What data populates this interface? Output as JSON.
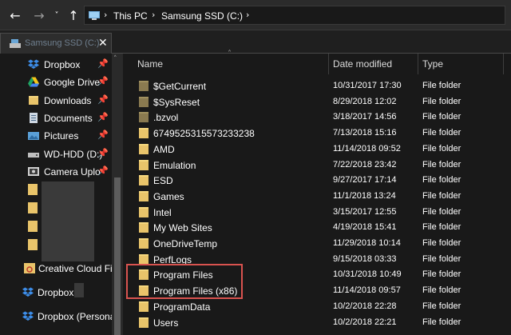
{
  "address_bar": {
    "path": [
      "This PC",
      "Samsung SSD (C:)"
    ]
  },
  "tab": {
    "label": "Samsung SSD (C:)"
  },
  "sidebar": {
    "items": [
      {
        "label": "Dropbox",
        "icon": "dropbox-icon",
        "pinned": true
      },
      {
        "label": "Google Drive",
        "icon": "google-drive-icon",
        "pinned": true
      },
      {
        "label": "Downloads",
        "icon": "folder-icon",
        "pinned": true
      },
      {
        "label": "Documents",
        "icon": "documents-icon",
        "pinned": true
      },
      {
        "label": "Pictures",
        "icon": "pictures-icon",
        "pinned": true
      },
      {
        "label": "WD-HDD (D:)",
        "icon": "drive-icon",
        "pinned": true
      },
      {
        "label": "Camera Uplo",
        "icon": "camera-icon",
        "pinned": true
      },
      {
        "label": "Creative Cloud Fil",
        "icon": "creative-cloud-icon",
        "pinned": false
      },
      {
        "label": "Dropbox",
        "icon": "dropbox-icon",
        "pinned": false
      },
      {
        "label": "Dropbox (Persona",
        "icon": "dropbox-icon",
        "pinned": false
      }
    ]
  },
  "columns": {
    "name": "Name",
    "date": "Date modified",
    "type": "Type"
  },
  "files": [
    {
      "name": "$GetCurrent",
      "date": "10/31/2017 17:30",
      "type": "File folder",
      "system": true
    },
    {
      "name": "$SysReset",
      "date": "8/29/2018 12:02",
      "type": "File folder",
      "system": true
    },
    {
      "name": ".bzvol",
      "date": "3/18/2017 14:56",
      "type": "File folder",
      "system": true
    },
    {
      "name": "6749525315573233238",
      "date": "7/13/2018 15:16",
      "type": "File folder",
      "system": false
    },
    {
      "name": "AMD",
      "date": "11/14/2018 09:52",
      "type": "File folder",
      "system": false
    },
    {
      "name": "Emulation",
      "date": "7/22/2018 23:42",
      "type": "File folder",
      "system": false
    },
    {
      "name": "ESD",
      "date": "9/27/2017 17:14",
      "type": "File folder",
      "system": false
    },
    {
      "name": "Games",
      "date": "11/1/2018 13:24",
      "type": "File folder",
      "system": false
    },
    {
      "name": "Intel",
      "date": "3/15/2017 12:55",
      "type": "File folder",
      "system": false
    },
    {
      "name": "My Web Sites",
      "date": "4/19/2018 15:41",
      "type": "File folder",
      "system": false
    },
    {
      "name": "OneDriveTemp",
      "date": "11/29/2018 10:14",
      "type": "File folder",
      "system": false
    },
    {
      "name": "PerfLogs",
      "date": "9/15/2018 03:33",
      "type": "File folder",
      "system": false
    },
    {
      "name": "Program Files",
      "date": "10/31/2018 10:49",
      "type": "File folder",
      "system": false
    },
    {
      "name": "Program Files (x86)",
      "date": "11/14/2018 09:57",
      "type": "File folder",
      "system": false
    },
    {
      "name": "ProgramData",
      "date": "10/2/2018 22:28",
      "type": "File folder",
      "system": false
    },
    {
      "name": "Users",
      "date": "10/2/2018 22:21",
      "type": "File folder",
      "system": false
    }
  ],
  "colors": {
    "highlight": "#d9534f",
    "folder": "#e9c46a",
    "background": "#191919"
  }
}
